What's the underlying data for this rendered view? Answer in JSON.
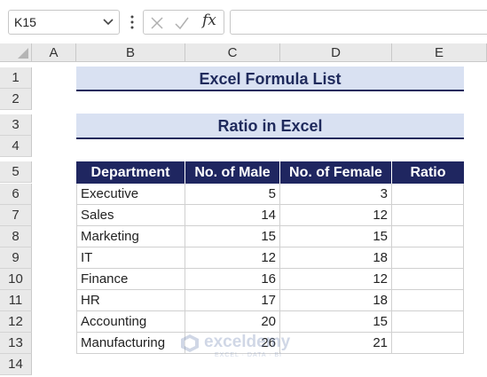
{
  "formula_bar": {
    "name_box": "K15",
    "fx": "fx",
    "formula": ""
  },
  "columns": [
    "A",
    "B",
    "C",
    "D",
    "E"
  ],
  "rows": [
    "1",
    "2",
    "3",
    "4",
    "5",
    "6",
    "7",
    "8",
    "9",
    "10",
    "11",
    "12",
    "13",
    "14"
  ],
  "sheet": {
    "title": "Excel Formula List",
    "subtitle": "Ratio in Excel",
    "table": {
      "headers": [
        "Department",
        "No. of Male",
        "No. of Female",
        "Ratio"
      ],
      "rows": [
        [
          "Executive",
          "5",
          "3",
          ""
        ],
        [
          "Sales",
          "14",
          "12",
          ""
        ],
        [
          "Marketing",
          "15",
          "15",
          ""
        ],
        [
          "IT",
          "12",
          "18",
          ""
        ],
        [
          "Finance",
          "16",
          "12",
          ""
        ],
        [
          "HR",
          "17",
          "18",
          ""
        ],
        [
          "Accounting",
          "20",
          "15",
          ""
        ],
        [
          "Manufacturing",
          "26",
          "21",
          ""
        ]
      ]
    }
  },
  "watermark": {
    "name": "exceldemy",
    "tagline": "EXCEL · DATA · BI"
  },
  "colors": {
    "header_fill": "#1f2660",
    "title_fill": "#d9e1f2",
    "title_text": "#1f2a5c"
  }
}
